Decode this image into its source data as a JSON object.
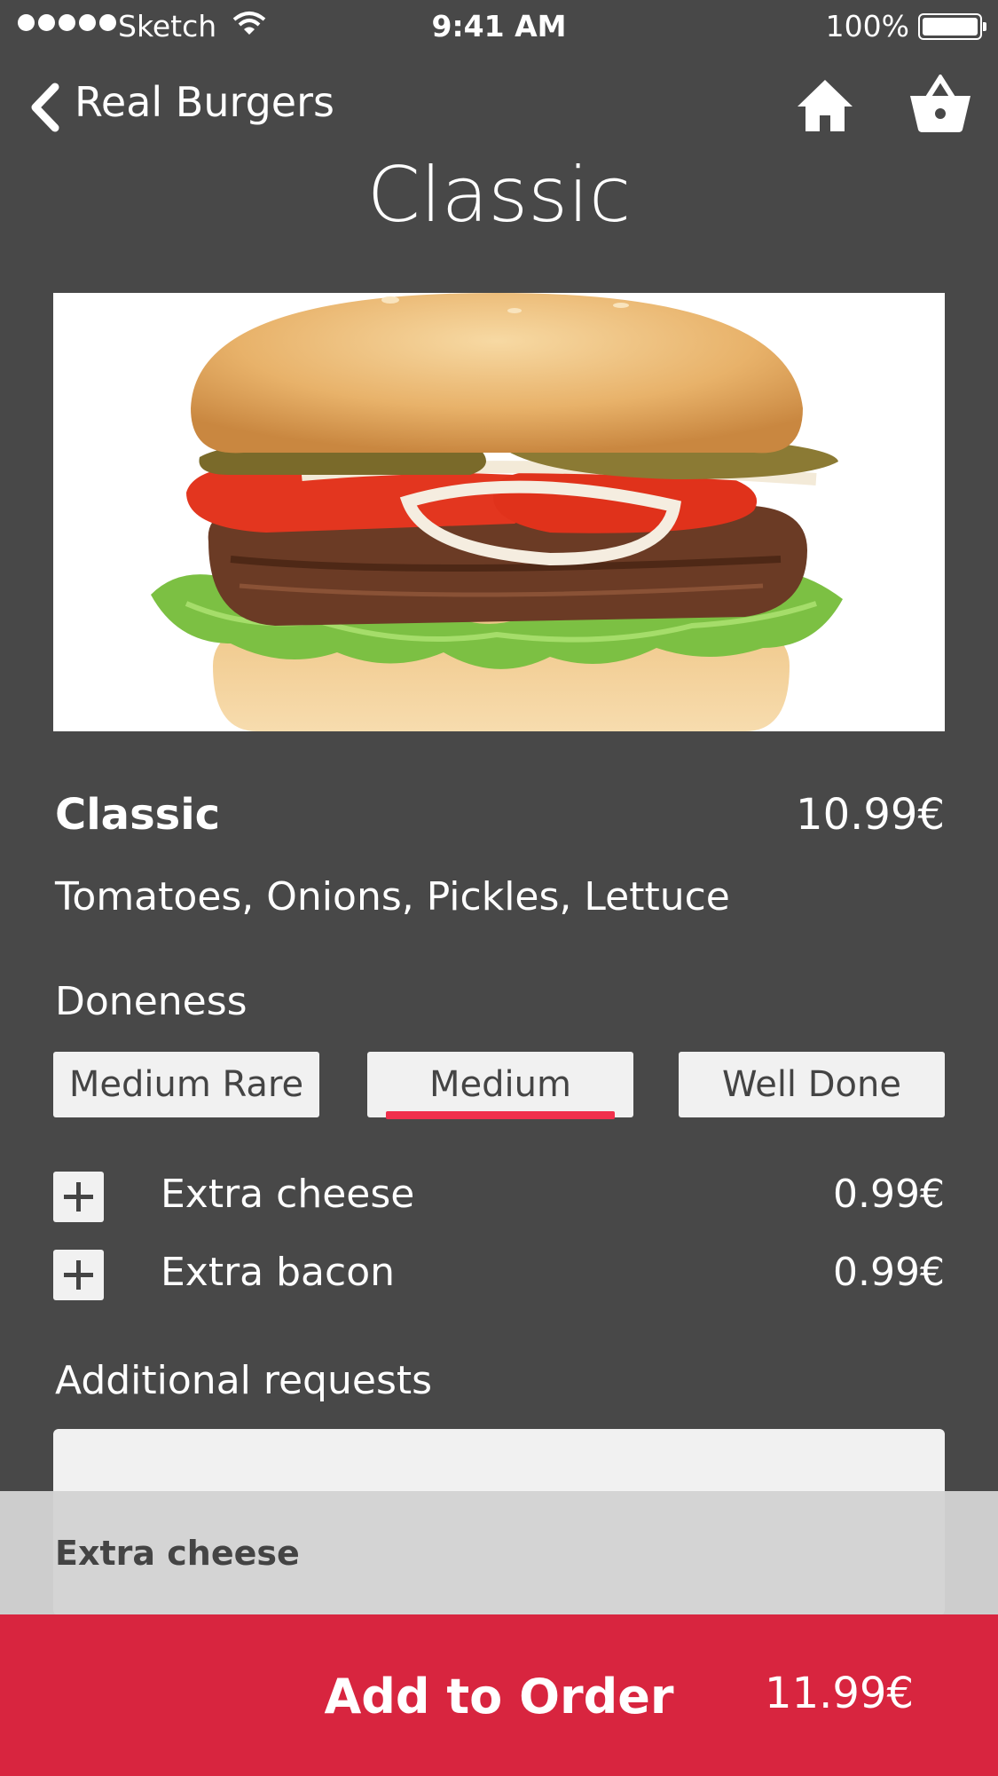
{
  "status_bar": {
    "carrier": "Sketch",
    "time": "9:41 AM",
    "battery": "100%"
  },
  "nav": {
    "back_label": "Real Burgers",
    "title": "Classic"
  },
  "item": {
    "name": "Classic",
    "price": "10.99€",
    "description": "Tomatoes, Onions, Pickles, Lettuce"
  },
  "doneness": {
    "label": "Doneness",
    "options": [
      "Medium Rare",
      "Medium",
      "Well Done"
    ],
    "selected": "Medium"
  },
  "extras": [
    {
      "label": "Extra cheese",
      "price": "0.99€"
    },
    {
      "label": "Extra bacon",
      "price": "0.99€"
    }
  ],
  "requests": {
    "label": "Additional requests",
    "suggestion": "Extra cheese"
  },
  "order": {
    "label": "Add to Order",
    "total": "11.99€"
  },
  "colors": {
    "background": "#484848",
    "accent": "#d8253f",
    "underline": "#f0304c"
  }
}
